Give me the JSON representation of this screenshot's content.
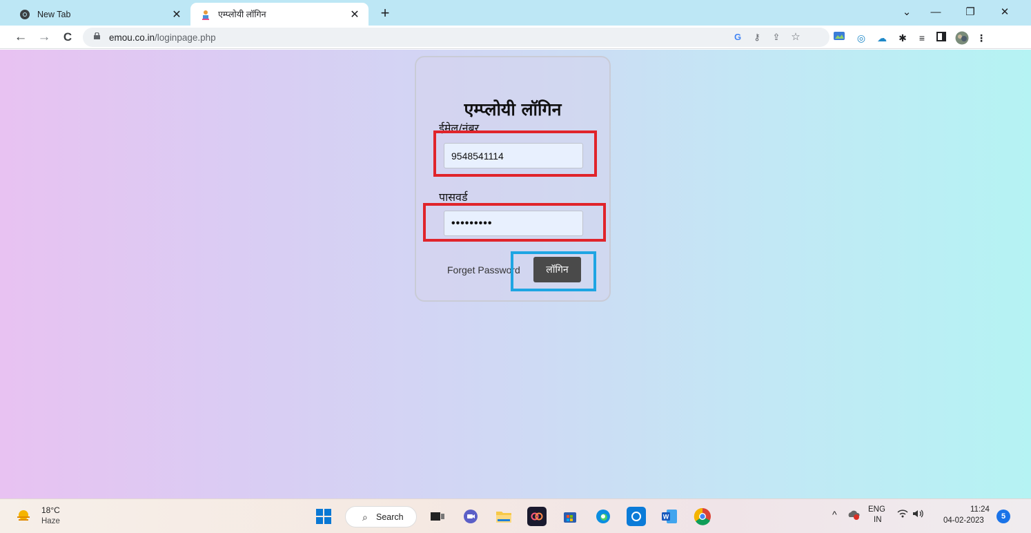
{
  "browser": {
    "tabs": [
      {
        "title": "New Tab",
        "close": "✕"
      },
      {
        "title": "एम्प्लोयी लॉगिन",
        "close": "✕"
      }
    ],
    "new_tab": "+",
    "window_controls": {
      "tablist": "⌄",
      "minimize": "—",
      "restore": "❐",
      "close": "✕"
    },
    "nav": {
      "back": "←",
      "forward": "→",
      "reload": "C"
    },
    "url": {
      "domain": "emou.co.in",
      "path": "/loginpage.php"
    }
  },
  "login": {
    "title": "एम्प्लोयी लॉगिन",
    "email_label": "ईमेल/नंबर",
    "email_value": "9548541114",
    "password_label": "पासवर्ड",
    "password_value": "•••••••••",
    "forget_label": "Forget Password",
    "login_button": "लॉगिन"
  },
  "taskbar": {
    "weather": {
      "temp": "18°C",
      "desc": "Haze"
    },
    "search_label": "Search",
    "tray": {
      "lang_top": "ENG",
      "lang_bottom": "IN",
      "time": "11:24",
      "date": "04-02-2023",
      "notifications": "5"
    }
  },
  "colors": {
    "highlight_red": "#e0242b",
    "highlight_blue": "#1ea5e3",
    "login_button_bg": "#4a4a4a",
    "page_gradient_start": "#e8c2f2",
    "page_gradient_end": "#b5f3f3"
  }
}
